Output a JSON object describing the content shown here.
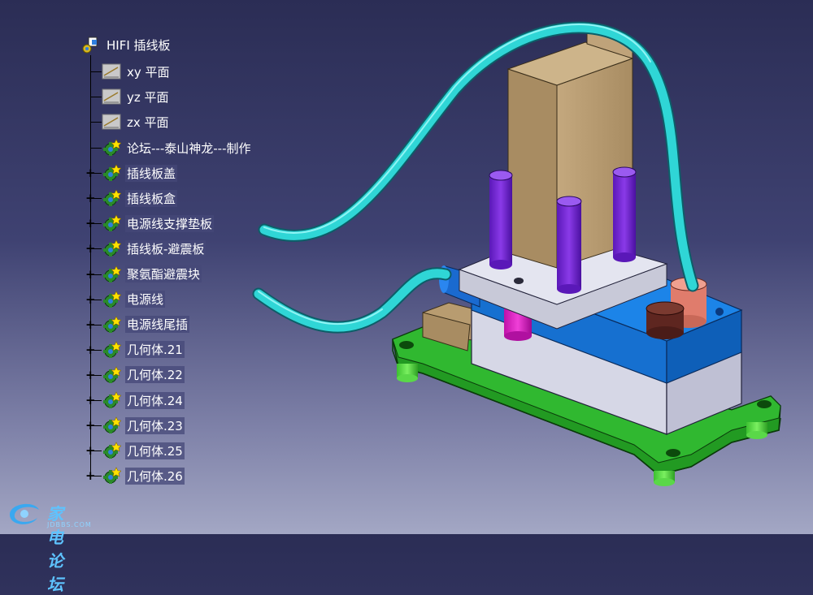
{
  "tree": {
    "root": {
      "label": "HIFI 插线板",
      "icon": "product-icon"
    },
    "planes": [
      {
        "label": "xy 平面",
        "icon": "plane-icon"
      },
      {
        "label": "yz 平面",
        "icon": "plane-icon"
      },
      {
        "label": "zx 平面",
        "icon": "plane-icon"
      }
    ],
    "bodies": [
      {
        "label": "论坛---泰山神龙---制作",
        "icon": "part-body-icon",
        "expandable": false
      },
      {
        "label": "插线板盖",
        "icon": "part-body-icon",
        "expandable": true
      },
      {
        "label": "插线板盒",
        "icon": "part-body-icon",
        "expandable": true
      },
      {
        "label": "电源线支撑垫板",
        "icon": "part-body-icon",
        "expandable": true
      },
      {
        "label": "插线板-避震板",
        "icon": "part-body-icon",
        "expandable": true
      },
      {
        "label": "聚氨酯避震块",
        "icon": "part-body-icon",
        "expandable": true
      },
      {
        "label": "电源线",
        "icon": "part-body-icon",
        "expandable": true
      },
      {
        "label": "电源线尾插",
        "icon": "part-body-icon",
        "expandable": true
      },
      {
        "label": "几何体.21",
        "icon": "part-body-icon",
        "expandable": true
      },
      {
        "label": "几何体.22",
        "icon": "part-body-icon",
        "expandable": true
      },
      {
        "label": "几何体.24",
        "icon": "part-body-icon",
        "expandable": true
      },
      {
        "label": "几何体.23",
        "icon": "part-body-icon",
        "expandable": true
      },
      {
        "label": "几何体.25",
        "icon": "part-body-icon",
        "expandable": true
      },
      {
        "label": "几何体.26",
        "icon": "part-body-icon",
        "expandable": true
      }
    ]
  },
  "watermark": {
    "main": "家电论坛",
    "sub": "JDBBS.COM"
  },
  "colors": {
    "background_top": "#2b2d55",
    "background_bottom": "#a3a7c4",
    "cable": "#2fd6d6",
    "base_plate": "#2aa82a",
    "feet": "#55e040",
    "housing_blue": "#1a78d8",
    "housing_light": "#d8d9e6",
    "block": "#bfa37a",
    "pins_purple": "#7a2ad8",
    "pin_magenta": "#e020c8",
    "socket_salmon": "#e88878",
    "socket_brown": "#6a2c26"
  }
}
